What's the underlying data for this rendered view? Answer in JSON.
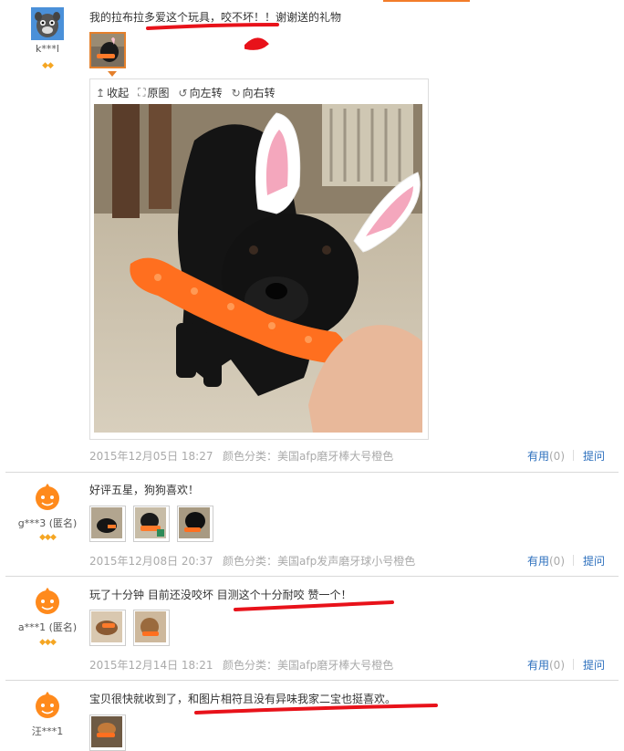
{
  "reviews": [
    {
      "user": "k***l",
      "text": "我的拉布拉多爱这个玩具，咬不坏！！谢谢送的礼物",
      "date": "2015年12月05日 18:27",
      "sku": "颜色分类：美国afp磨牙棒大号橙色",
      "useful_label": "有用",
      "useful_count": "(0)",
      "ask_label": "提问"
    },
    {
      "user": "g***3 (匿名)",
      "text": "好评五星，狗狗喜欢！",
      "date": "2015年12月08日 20:37",
      "sku": "颜色分类：美国afp发声磨牙球小号橙色",
      "useful_label": "有用",
      "useful_count": "(0)",
      "ask_label": "提问"
    },
    {
      "user": "a***1 (匿名)",
      "text": "玩了十分钟 目前还没咬坏 目测这个十分耐咬 赞一个！",
      "date": "2015年12月14日 18:21",
      "sku": "颜色分类：美国afp磨牙棒大号橙色",
      "useful_label": "有用",
      "useful_count": "(0)",
      "ask_label": "提问"
    },
    {
      "user": "汪***1",
      "text": "宝贝很快就收到了，和图片相符且没有异味我家二宝也挺喜欢。"
    }
  ],
  "viewer": {
    "collapse_label": "收起",
    "original_label": "原图",
    "rotate_left_label": "向左转",
    "rotate_right_label": "向右转"
  },
  "icons": {
    "collapse": "collapse-arrow-icon",
    "original": "expand-icon",
    "rotate_left": "rotate-left-icon",
    "rotate_right": "rotate-right-icon",
    "membership": "diamond-icon"
  },
  "colors": {
    "link": "#2c6fbd",
    "meta": "#aaaaaa",
    "accent": "#e4802c",
    "annotation": "#e8121a"
  }
}
